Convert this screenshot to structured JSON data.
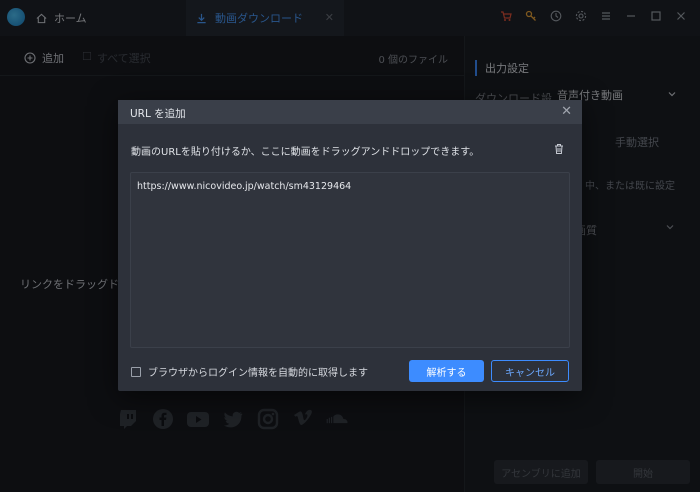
{
  "titlebar": {
    "home_label": "ホーム",
    "active_tab_label": "動画ダウンロード"
  },
  "left": {
    "add_label": "追加",
    "select_all_label": "すべて選択",
    "file_count": "0 個のファイル",
    "drop_hint": "リンクをドラッグドロ"
  },
  "right": {
    "output_title": "出力設定",
    "download_label": "ダウンロード設",
    "download_value": "音声付き動画",
    "manual_label": "手動選択",
    "desc_text": "中、または既に設定",
    "quality_label": "画質"
  },
  "bottom": {
    "assemble_label": "アセンブリに追加",
    "start_label": "開始"
  },
  "dialog": {
    "title": "URL を追加",
    "instruction": "動画のURLを貼り付けるか、ここに動画をドラッグアンドドロップできます。",
    "url_value": "https://www.nicovideo.jp/watch/sm43129464",
    "checkbox_label": "ブラウザからログイン情報を自動的に取得します",
    "parse_label": "解析する",
    "cancel_label": "キャンセル"
  },
  "colors": {
    "accent": "#3d8cff",
    "bg": "#181a20",
    "dialog_bg": "#2d313a"
  }
}
